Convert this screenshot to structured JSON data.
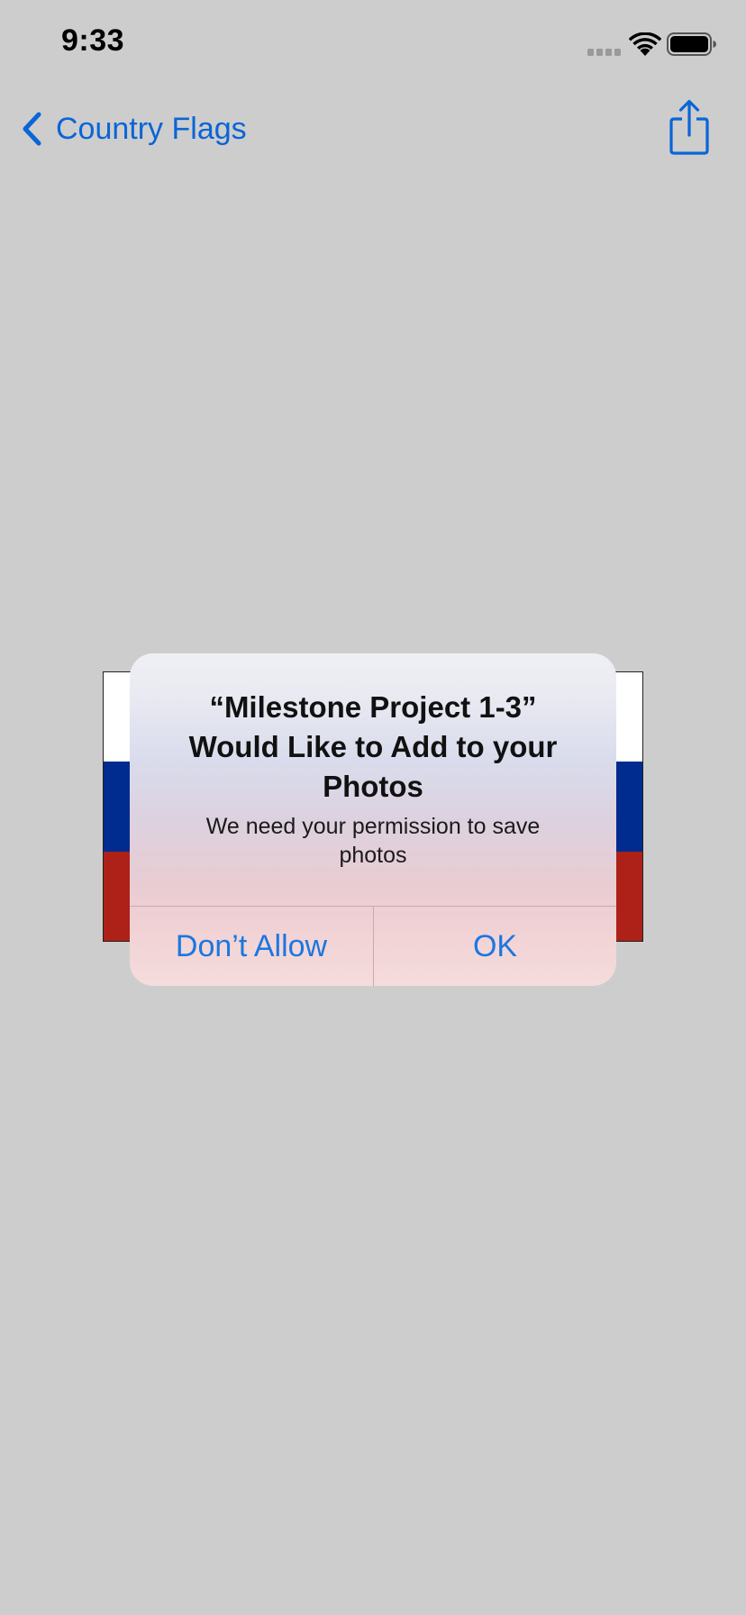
{
  "status_bar": {
    "time": "9:33",
    "icons": [
      "cellular-signal-icon",
      "wifi-icon",
      "battery-icon"
    ]
  },
  "nav": {
    "back_label": "Country Flags",
    "back_icon": "chevron-left-icon",
    "share_icon": "share-icon"
  },
  "flag": {
    "stripe_colors": [
      "#ffffff",
      "#002b8f",
      "#ad2119"
    ]
  },
  "alert": {
    "title": "“Milestone Project 1-3” Would Like to Add to your Photos",
    "message": "We need your permission to save photos",
    "buttons": {
      "deny": "Don’t Allow",
      "ok": "OK"
    }
  },
  "colors": {
    "accent": "#0a65d6",
    "alert_button": "#1b77e0",
    "background": "#cdcdcd"
  }
}
